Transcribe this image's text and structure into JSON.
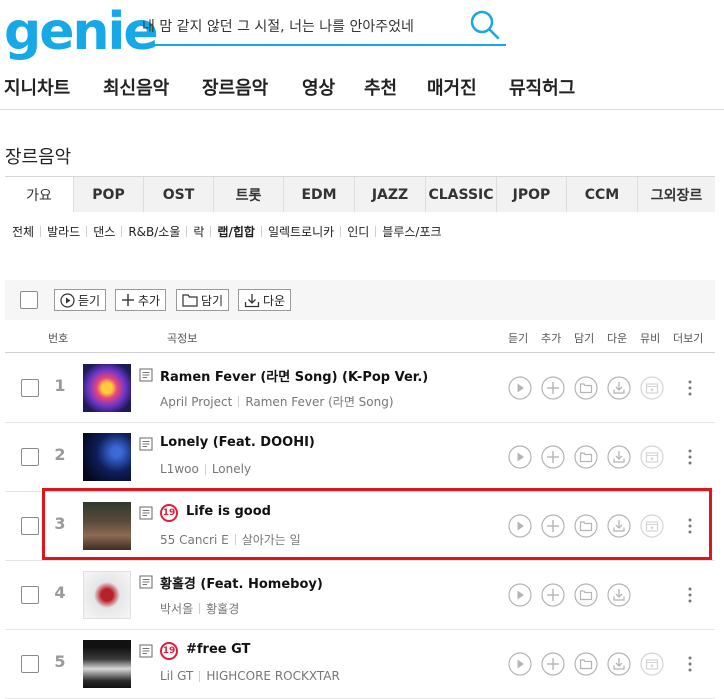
{
  "header": {
    "logo": "genie",
    "search_value": "내 맘 같지 않던 그 시절, 너는 나를 안아주었네"
  },
  "gnb": [
    "지니차트",
    "최신음악",
    "장르음악",
    "영상",
    "추천",
    "매거진",
    "뮤직허그"
  ],
  "section_title": "장르음악",
  "tabs": [
    "가요",
    "POP",
    "OST",
    "트롯",
    "EDM",
    "JAZZ",
    "CLASSIC",
    "JPOP",
    "CCM",
    "그외장르"
  ],
  "active_tab": "가요",
  "subgenres": [
    "전체",
    "발라드",
    "댄스",
    "R&B/소울",
    "락",
    "랩/힙합",
    "일렉트로니카",
    "인디",
    "블루스/포크"
  ],
  "selected_subgenre": "랩/힙합",
  "actions": {
    "listen": "듣기",
    "add": "추가",
    "save": "담기",
    "download": "다운"
  },
  "columns": {
    "no": "번호",
    "info": "곡정보",
    "listen": "듣기",
    "add": "추가",
    "save": "담기",
    "download": "다운",
    "mv": "뮤비",
    "more": "더보기"
  },
  "tracks": [
    {
      "rank": "1",
      "title": "Ramen Fever (라면 Song) (K-Pop Ver.)",
      "artist": "April Project",
      "album": "Ramen Fever (라면 Song)",
      "adult": false
    },
    {
      "rank": "2",
      "title": "Lonely (Feat. DOOHI)",
      "artist": "L1woo",
      "album": "Lonely",
      "adult": false
    },
    {
      "rank": "3",
      "title": "Life is good",
      "artist": "55 Cancri E",
      "album": "살아가는 일",
      "adult": true
    },
    {
      "rank": "4",
      "title": "황홀경 (Feat. Homeboy)",
      "artist": "박서올",
      "album": "황홀경",
      "adult": false
    },
    {
      "rank": "5",
      "title": "#free GT",
      "artist": "Lil GT",
      "album": "HIGHCORE ROCKXTAR",
      "adult": true
    }
  ],
  "adult_badge": "19",
  "colors": {
    "brand": "#17a8e8",
    "highlight": "#e0151b",
    "adult": "#e01e3c"
  }
}
